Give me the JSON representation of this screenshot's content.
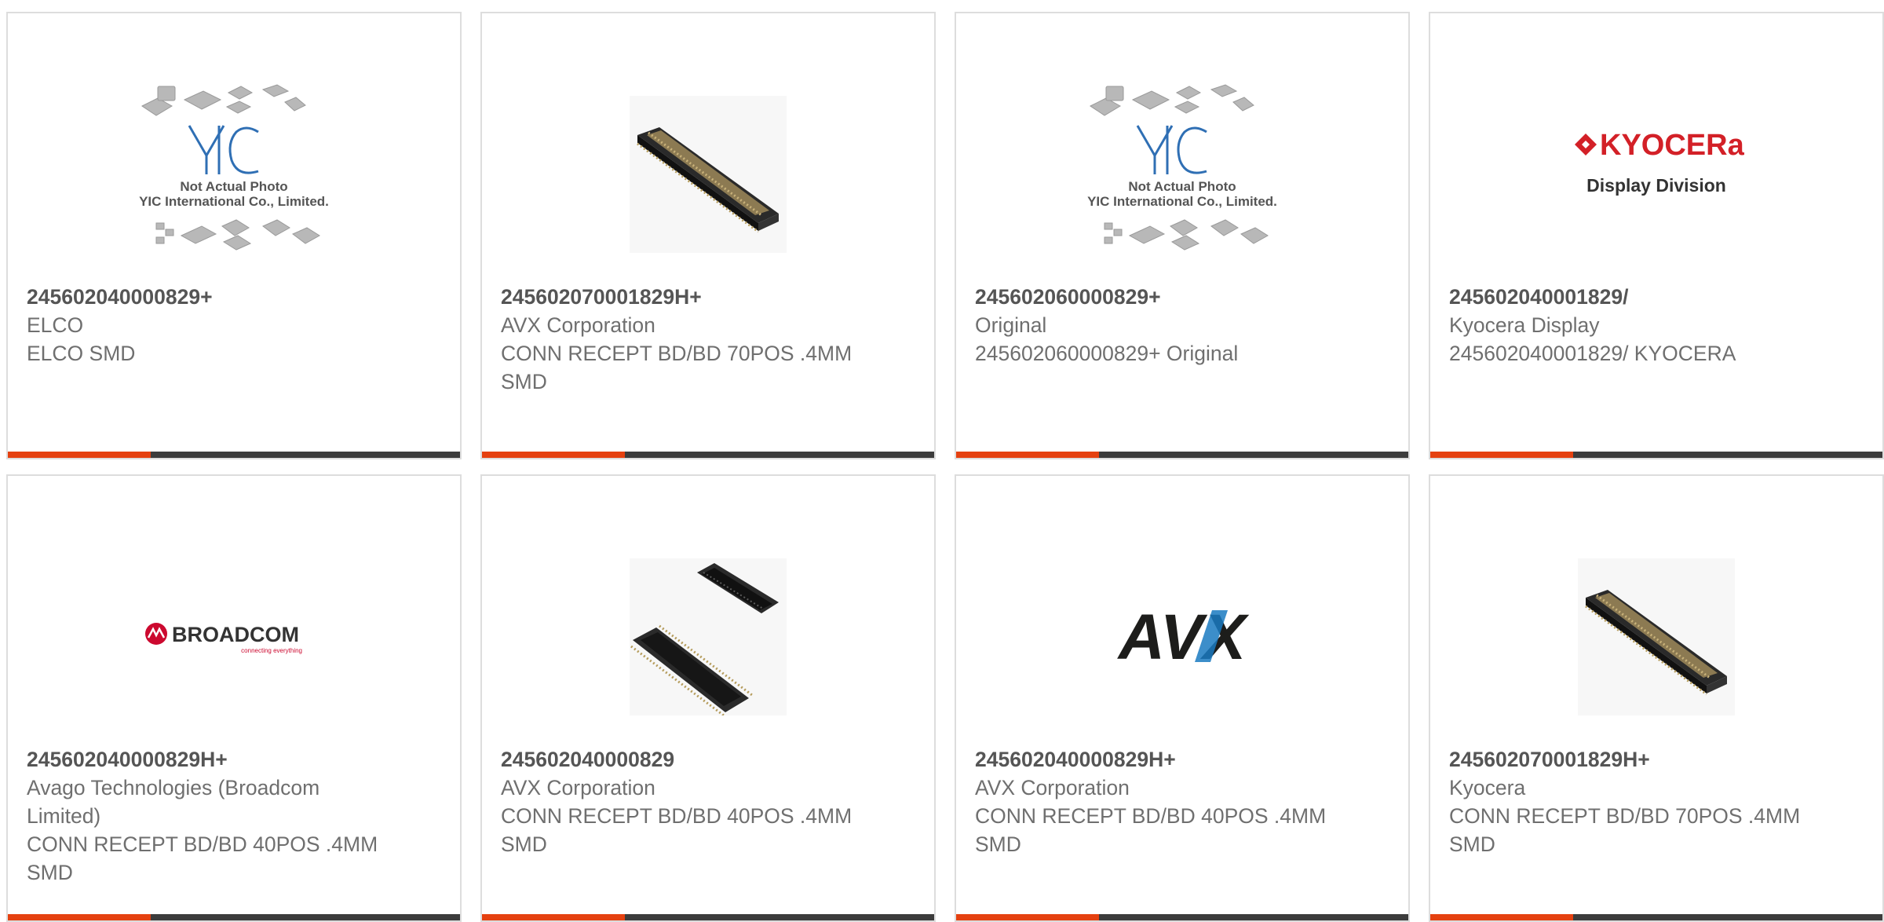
{
  "products": [
    {
      "part_number": "245602040000829+",
      "manufacturer": "ELCO",
      "description": "ELCO SMD",
      "image": {
        "kind": "not-actual-photo",
        "line1": "Not Actual Photo",
        "line2": "YIC International Co., Limited.",
        "logo": "YIC"
      }
    },
    {
      "part_number": "245602070001829H+",
      "manufacturer": "AVX Corporation",
      "description": "CONN RECEPT BD/BD 70POS .4MM SMD",
      "image": {
        "kind": "connector-single"
      }
    },
    {
      "part_number": "245602060000829+",
      "manufacturer": "Original",
      "description": "245602060000829+ Original",
      "image": {
        "kind": "not-actual-photo",
        "line1": "Not Actual Photo",
        "line2": "YIC International Co., Limited.",
        "logo": "YIC"
      }
    },
    {
      "part_number": "245602040001829/",
      "manufacturer": "Kyocera Display",
      "description": "245602040001829/ KYOCERA",
      "image": {
        "kind": "kyocera-logo",
        "logo": "KYOCERa",
        "subtitle": "Display Division"
      }
    },
    {
      "part_number": "245602040000829H+",
      "manufacturer": "Avago Technologies (Broadcom Limited)",
      "description": "CONN RECEPT BD/BD 40POS .4MM SMD",
      "image": {
        "kind": "broadcom-logo",
        "logo": "BROADCOM",
        "tagline": "connecting everything"
      }
    },
    {
      "part_number": "245602040000829",
      "manufacturer": "AVX Corporation",
      "description": "CONN RECEPT BD/BD 40POS .4MM SMD",
      "image": {
        "kind": "connector-pair"
      }
    },
    {
      "part_number": "245602040000829H+",
      "manufacturer": "AVX Corporation",
      "description": "CONN RECEPT BD/BD 40POS .4MM SMD",
      "image": {
        "kind": "avx-logo",
        "logo": "AVX"
      }
    },
    {
      "part_number": "245602070001829H+",
      "manufacturer": "Kyocera",
      "description": "CONN RECEPT BD/BD 70POS .4MM SMD",
      "image": {
        "kind": "connector-single"
      }
    }
  ],
  "colors": {
    "accent": "#e54110",
    "bar": "#3c3c3c",
    "card_border": "#dddddd",
    "text": "#6f6f6f",
    "part_number": "#555555",
    "yic_blue": "#2f6fb4",
    "kyocera_red": "#d32027",
    "broadcom_red": "#cc092f",
    "avx_dark": "#1d1d1b",
    "avx_blue": "#1a7ac1"
  }
}
